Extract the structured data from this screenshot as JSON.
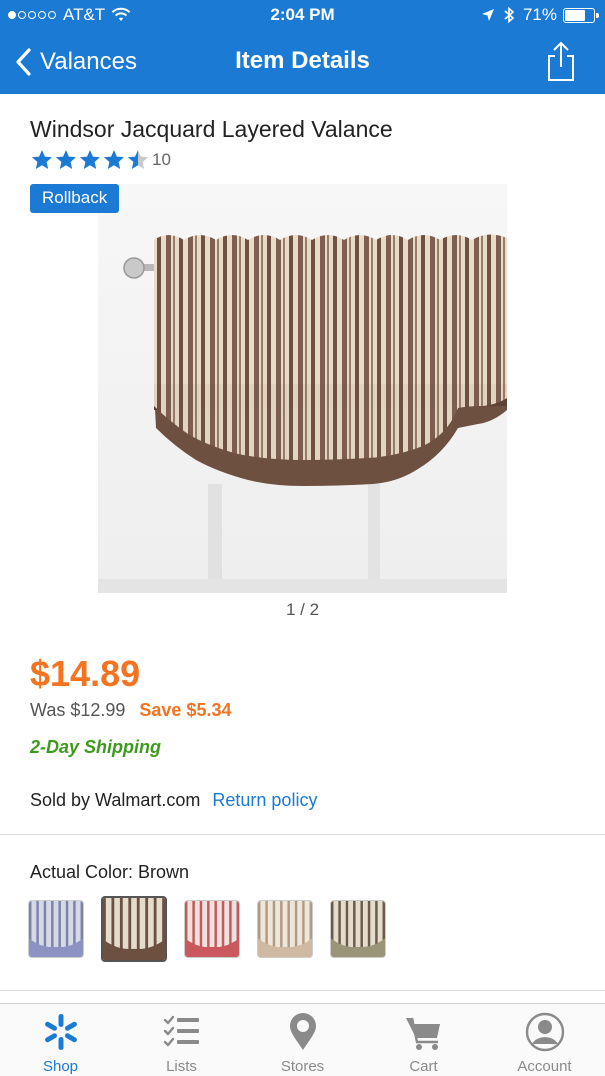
{
  "status_bar": {
    "carrier": "AT&T",
    "time": "2:04 PM",
    "battery": "71%",
    "battery_level": 0.71,
    "signal_bars": 1,
    "signal_total": 5
  },
  "nav": {
    "back_label": "Valances",
    "title": "Item Details"
  },
  "product": {
    "title": "Windsor Jacquard Layered Valance",
    "rating": 4.5,
    "review_count": "10",
    "badge": "Rollback",
    "image_counter": "1 / 2",
    "price": "$14.89",
    "was_price": "Was $12.99",
    "save": "Save $5.34",
    "shipping": "2-Day Shipping",
    "sold_by": "Sold by Walmart.com",
    "return_policy": "Return policy"
  },
  "colors": {
    "label": "Actual Color: Brown",
    "swatches": [
      {
        "name": "blue",
        "stripe": "#7a84a8",
        "base": "#d7d9e8",
        "band": "#8c93c2"
      },
      {
        "name": "brown",
        "stripe": "#6b5046",
        "base": "#e6dccb",
        "band": "#6d5040",
        "selected": true
      },
      {
        "name": "red",
        "stripe": "#c25a5a",
        "base": "#f0e1df",
        "band": "#c9595e"
      },
      {
        "name": "tan",
        "stripe": "#b09a84",
        "base": "#efe6db",
        "band": "#cfb9a3"
      },
      {
        "name": "sage",
        "stripe": "#6e5a48",
        "base": "#e4dccd",
        "band": "#9a9478"
      }
    ]
  },
  "tabs": [
    {
      "label": "Shop",
      "icon": "spark-icon",
      "active": true
    },
    {
      "label": "Lists",
      "icon": "list-icon",
      "active": false
    },
    {
      "label": "Stores",
      "icon": "store-pin-icon",
      "active": false
    },
    {
      "label": "Cart",
      "icon": "cart-icon",
      "active": false
    },
    {
      "label": "Account",
      "icon": "account-icon",
      "active": false
    }
  ],
  "colors_theme": {
    "brand_blue": "#1a7ad4",
    "price_orange": "#f47321",
    "shipping_green": "#3d9b1c"
  }
}
